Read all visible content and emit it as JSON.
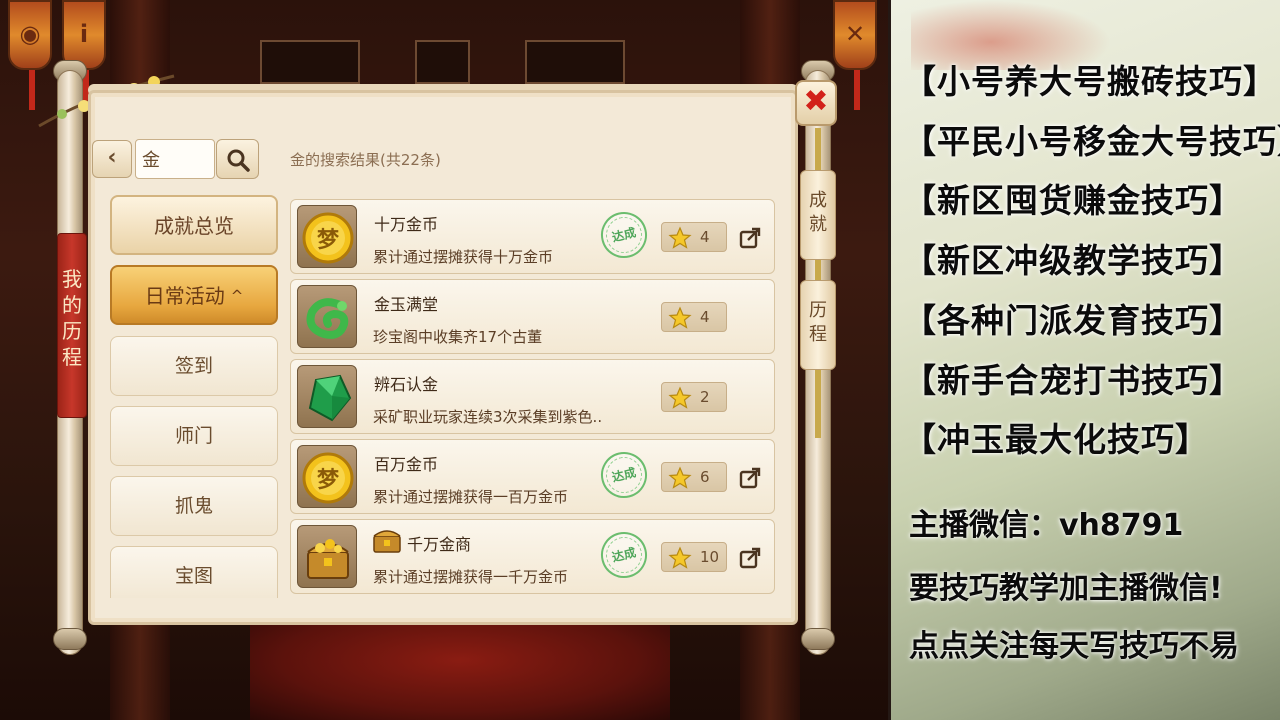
{
  "colors": {
    "accent_gold": "#e7a73f",
    "close_red": "#d2211a",
    "stamp_green": "#4fa65a",
    "panel_bg": "#f3e9d7"
  },
  "game": {
    "side_title": [
      "我",
      "的",
      "历",
      "程"
    ],
    "toolbar": {
      "back_icon": "chevron-left-icon",
      "search_value": "金",
      "search_icon": "search-icon"
    },
    "result_title": "金的搜索结果(共22条)",
    "close_icon": "close-icon",
    "right_tabs": [
      {
        "label_chars": [
          "成",
          "就"
        ]
      },
      {
        "label_chars": [
          "历",
          "程"
        ]
      }
    ],
    "menu": [
      {
        "label": "成就总览"
      },
      {
        "label": "日常活动",
        "caret": "^"
      },
      {
        "label": "签到"
      },
      {
        "label": "师门"
      },
      {
        "label": "抓鬼"
      },
      {
        "label": "宝图"
      }
    ],
    "results": [
      {
        "icon": "gold-coin-icon",
        "name": "十万金币",
        "desc": "累计通过摆摊获得十万金币",
        "completed": true,
        "stamp": "达成",
        "stars": "4",
        "share": true
      },
      {
        "icon": "jade-dragon-icon",
        "name": "金玉满堂",
        "desc": "珍宝阁中收集齐17个古董",
        "completed": false,
        "stars": "4",
        "share": false
      },
      {
        "icon": "emerald-stone-icon",
        "name": "辨石认金",
        "desc": "采矿职业玩家连续3次采集到紫色..",
        "completed": false,
        "stars": "2",
        "share": false
      },
      {
        "icon": "gold-coin-icon",
        "name": "百万金币",
        "desc": "累计通过摆摊获得一百万金币",
        "completed": true,
        "stamp": "达成",
        "stars": "6",
        "share": true
      },
      {
        "icon": "treasure-chest-icon",
        "name": "千万金商",
        "desc": "累计通过摆摊获得一千万金币",
        "completed": true,
        "stamp": "达成",
        "stars": "10",
        "share": true
      }
    ]
  },
  "info": {
    "tips": [
      "【小号养大号搬砖技巧】",
      "【平民小号移金大号技巧】",
      "【新区囤货赚金技巧】",
      "【新区冲级教学技巧】",
      "【各种门派发育技巧】",
      "【新手合宠打书技巧】",
      "【冲玉最大化技巧】"
    ],
    "wechat": "主播微信：vh8791",
    "line2": "要技巧教学加主播微信!",
    "line3": "点点关注每天写技巧不易"
  }
}
